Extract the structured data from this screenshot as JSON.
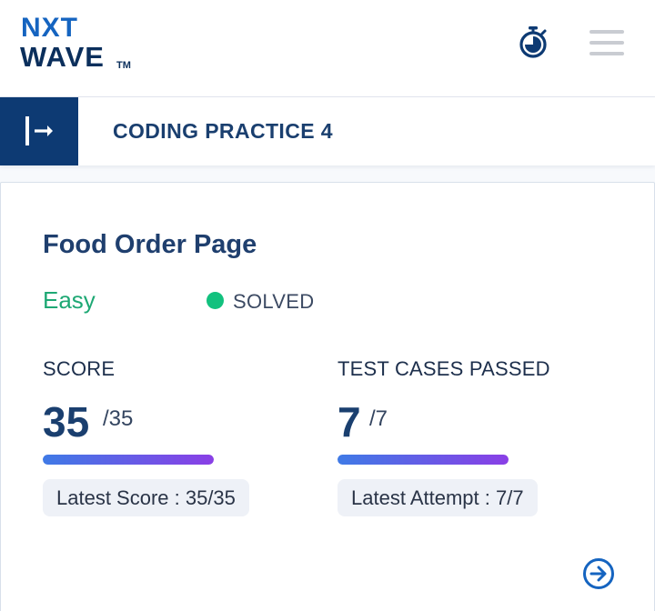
{
  "header": {
    "logo_text_top": "NXT",
    "logo_text_bottom": "WAVE",
    "logo_tm": "TM",
    "timer_icon": "stopwatch-icon",
    "menu_icon": "hamburger-menu-icon"
  },
  "subheader": {
    "toggle_icon": "sidebar-expand-icon",
    "title": "CODING PRACTICE 4"
  },
  "problem": {
    "title": "Food Order Page",
    "difficulty": "Easy",
    "status": "SOLVED",
    "score": {
      "label": "SCORE",
      "value": "35",
      "max": "/35",
      "progress_fraction": 1.0,
      "chip": "Latest Score : 35/35"
    },
    "tests": {
      "label": "TEST CASES PASSED",
      "value": "7",
      "max": "/7",
      "progress_fraction": 1.0,
      "chip": "Latest Attempt : 7/7"
    },
    "next_icon": "arrow-circle-right-icon"
  },
  "colors": {
    "brand_dark": "#0d3a73",
    "brand_blue": "#1564c0",
    "easy_green": "#1ea874",
    "solved_dot": "#12c17e",
    "progress_start": "#3f7ae6",
    "progress_end": "#8a3fe6"
  }
}
